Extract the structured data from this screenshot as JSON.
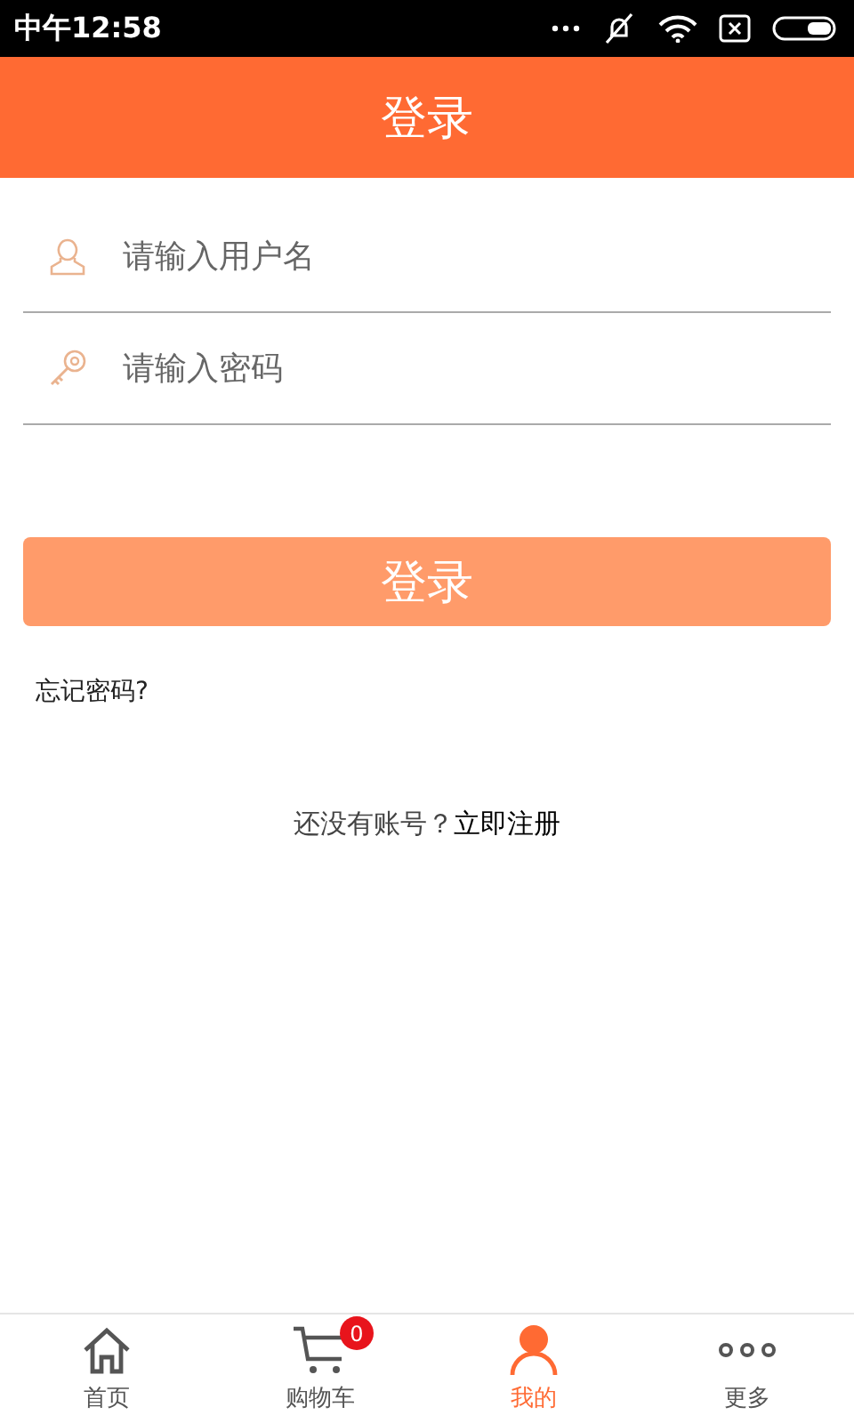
{
  "status_bar": {
    "time": "中午12:58"
  },
  "header": {
    "title": "登录"
  },
  "fields": [
    {
      "kind": "user",
      "placeholder": "请输入用户名"
    },
    {
      "kind": "key",
      "placeholder": "请输入密码"
    }
  ],
  "login_button": "登录",
  "forgot_link": "忘记密码?",
  "register": {
    "prompt": "还没有账号？",
    "link": "立即注册"
  },
  "tabs": [
    {
      "kind": "home",
      "label": "首页",
      "selected": false
    },
    {
      "kind": "cart",
      "label": "购物车",
      "selected": false,
      "badge": "0"
    },
    {
      "kind": "person",
      "label": "我的",
      "selected": true
    },
    {
      "kind": "more",
      "label": "更多",
      "selected": false
    }
  ]
}
